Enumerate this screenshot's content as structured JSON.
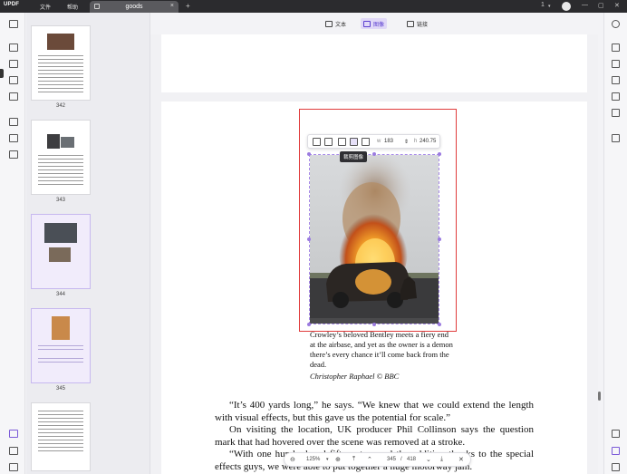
{
  "titlebar": {
    "logo": "UPDF",
    "menu_file": "文件",
    "menu_help": "帮助",
    "tab_title": "goods",
    "page_count_indicator": "1"
  },
  "toolbar": {
    "text_label": "文本",
    "image_label": "图像",
    "link_label": "链接"
  },
  "thumbnails": [
    {
      "label": "342"
    },
    {
      "label": "343"
    },
    {
      "label": "344"
    },
    {
      "label": "345"
    }
  ],
  "image_toolbar": {
    "w_label": "w",
    "w_value": "183",
    "h_label": "h",
    "h_value": "240.75",
    "tooltip": "裁剪图像"
  },
  "page": {
    "caption": "Crowley’s beloved Bentley meets a fiery end at the airbase, and yet as the owner is a demon there’s every chance it’ll come back from the dead.",
    "credit": "Christopher Raphael © BBC",
    "paragraphs": [
      "“It’s 400 yards long,” he says. “We knew that we could extend the length with visual effects, but this gave us the potential for scale.”",
      "On visiting the location, UK producer Phil Collinson says the question mark that had hovered over the scene was removed at a stroke.",
      "“With one hundred and fifty extras and the addition thanks to the special effects guys, we were able to put together a huge motorway jam."
    ]
  },
  "pagenav": {
    "zoom": "125%",
    "current_page": "345",
    "total_pages": "418",
    "separator": "/"
  },
  "colors": {
    "accent": "#5b3fd0",
    "selection_red": "#e03b3b",
    "titlebar": "#2b2b2e"
  }
}
